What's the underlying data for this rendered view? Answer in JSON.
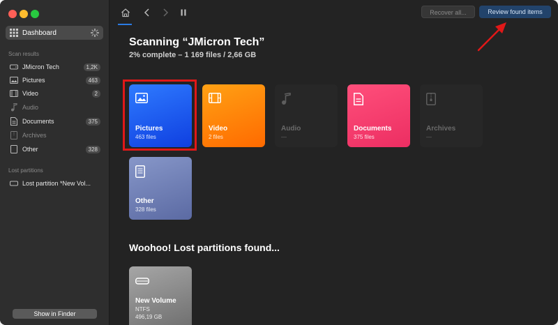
{
  "sidebar": {
    "dashboard_label": "Dashboard",
    "scan_results_header": "Scan results",
    "items": [
      {
        "label": "JMicron Tech",
        "badge": "1,2K",
        "icon": "drive-icon"
      },
      {
        "label": "Pictures",
        "badge": "463",
        "icon": "image-icon"
      },
      {
        "label": "Video",
        "badge": "2",
        "icon": "film-icon"
      },
      {
        "label": "Audio",
        "badge": "",
        "icon": "music-note-icon"
      },
      {
        "label": "Documents",
        "badge": "375",
        "icon": "document-icon"
      },
      {
        "label": "Archives",
        "badge": "",
        "icon": "archive-icon"
      },
      {
        "label": "Other",
        "badge": "328",
        "icon": "file-icon"
      }
    ],
    "lost_partitions_header": "Lost partitions",
    "lost_partition_item": "Lost partition *New Vol...",
    "show_in_finder": "Show in Finder"
  },
  "toolbar": {
    "recover_all": "Recover all...",
    "review_found": "Review found items"
  },
  "main": {
    "title": "Scanning “JMicron Tech”",
    "subtitle": "2% complete – 1 169 files / 2,66 GB",
    "tiles": [
      {
        "name": "Pictures",
        "count": "463 files",
        "color": "#1a56f0"
      },
      {
        "name": "Video",
        "count": "2 files",
        "color": "#ff7a00"
      },
      {
        "name": "Audio",
        "count": "—",
        "color": "#262626"
      },
      {
        "name": "Documents",
        "count": "375 files",
        "color": "#f23c6b"
      },
      {
        "name": "Archives",
        "count": "—",
        "color": "#262626"
      },
      {
        "name": "Other",
        "count": "328 files",
        "color": "#6f7fb5"
      }
    ],
    "lost_partitions_title": "Woohoo! Lost partitions found...",
    "partition": {
      "name": "New Volume",
      "fs": "NTFS",
      "size": "496,19 GB"
    }
  },
  "colors": {
    "accent": "#2b7be4",
    "highlight_frame": "#e01818",
    "annotation_arrow": "#e01818"
  }
}
